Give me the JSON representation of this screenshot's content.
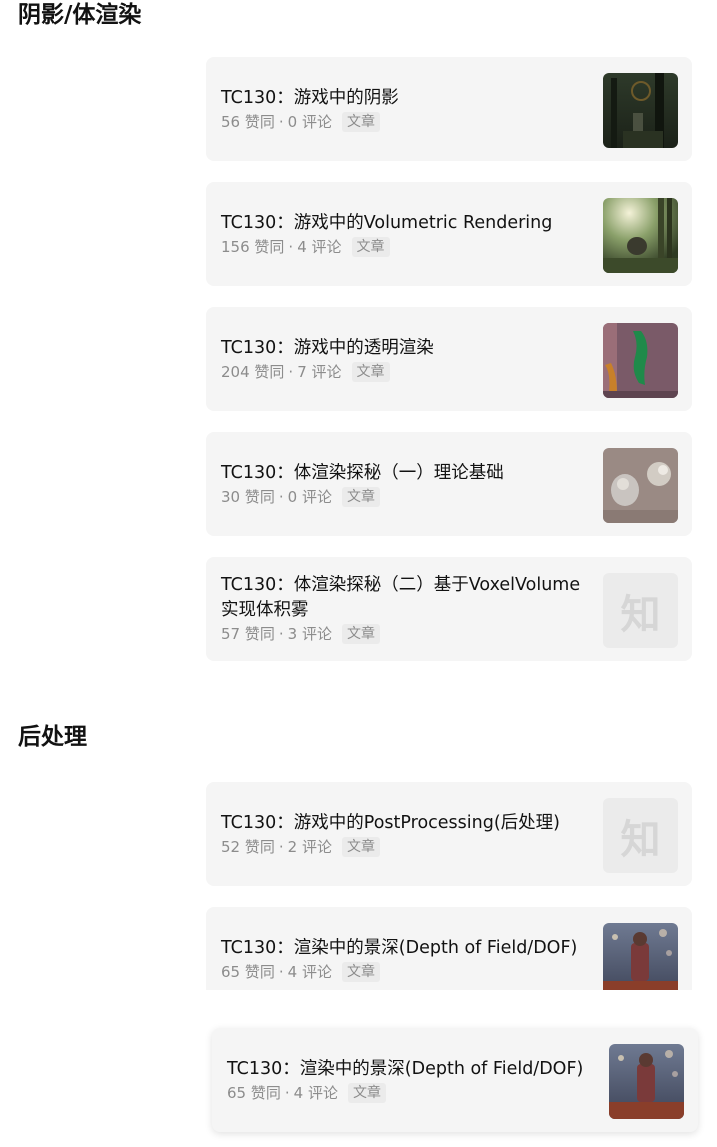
{
  "sections": [
    {
      "title": "阴影/体渲染"
    },
    {
      "title": "后处理"
    }
  ],
  "cards": [
    {
      "title": "TC130：游戏中的阴影",
      "likes": "56 赞同",
      "sep": "·",
      "comments": "0 评论",
      "tag": "文章"
    },
    {
      "title": "TC130：游戏中的Volumetric Rendering",
      "likes": "156 赞同",
      "sep": "·",
      "comments": "4 评论",
      "tag": "文章"
    },
    {
      "title": "TC130：游戏中的透明渲染",
      "likes": "204 赞同",
      "sep": "·",
      "comments": "7 评论",
      "tag": "文章"
    },
    {
      "title": "TC130：体渲染探秘（一）理论基础",
      "likes": "30 赞同",
      "sep": "·",
      "comments": "0 评论",
      "tag": "文章"
    },
    {
      "title": "TC130：体渲染探秘（二）基于VoxelVolume实现体积雾",
      "likes": "57 赞同",
      "sep": "·",
      "comments": "3 评论",
      "tag": "文章",
      "placeholder": "知"
    },
    {
      "title": "TC130：游戏中的PostProcessing(后处理)",
      "likes": "52 赞同",
      "sep": "·",
      "comments": "2 评论",
      "tag": "文章",
      "placeholder": "知"
    },
    {
      "title": "TC130：渲染中的景深(Depth of Field/DOF)",
      "likes": "65 赞同",
      "sep": "·",
      "comments": "4 评论",
      "tag": "文章"
    }
  ],
  "drag_card": {
    "title": "TC130：渲染中的景深(Depth of Field/DOF)",
    "likes": "65 赞同",
    "sep": "·",
    "comments": "4 评论",
    "tag": "文章"
  }
}
